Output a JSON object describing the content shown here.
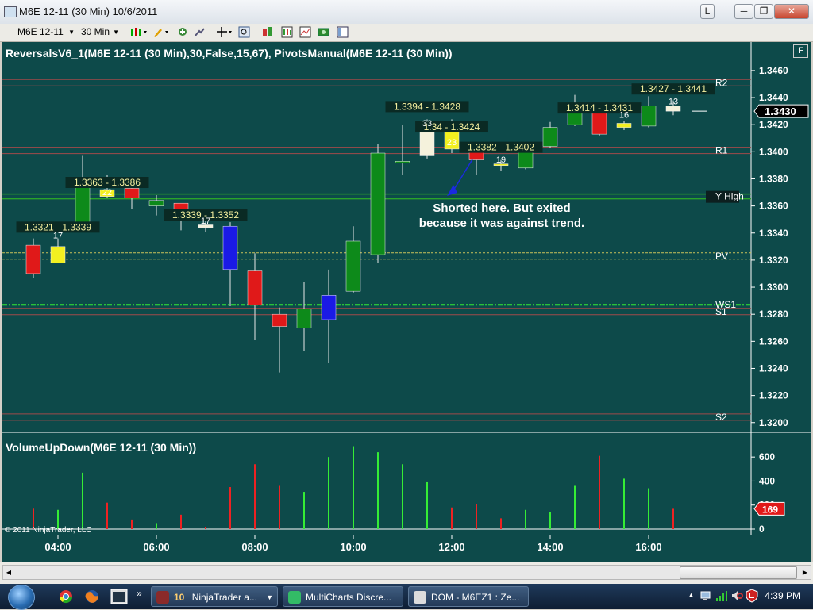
{
  "window": {
    "title": "M6E 12-11 (30 Min)  10/6/2011",
    "button_l": "L",
    "minimize": "─",
    "restore": "❐",
    "close": "✕"
  },
  "toolbar": {
    "instrument": "M6E 12-11",
    "period": "30 Min"
  },
  "price_panel": {
    "title": "ReversalsV6_1(M6E 12-11 (30 Min),30,False,15,67),  PivotsManual(M6E 12-11 (30 Min))",
    "f_button": "F",
    "price_ticks": [
      "1.3460",
      "1.3440",
      "1.3420",
      "1.3400",
      "1.3380",
      "1.3360",
      "1.3340",
      "1.3320",
      "1.3300",
      "1.3280",
      "1.3260",
      "1.3240",
      "1.3220",
      "1.3200"
    ],
    "last_price": "1.3430",
    "pivot_labels": {
      "r2": "R2",
      "r1": "R1",
      "yhigh": "Y High",
      "pv": "PV",
      "ws1": "WS1",
      "s1": "S1",
      "s2": "S2"
    },
    "annotation_text": [
      "Shorted here. But exited",
      "because it was against trend."
    ],
    "range_labels": [
      "1.3321 - 1.3339",
      "1.3363 - 1.3386",
      "1.3339 - 1.3352",
      "1.3394 - 1.3428",
      "1.34 - 1.3424",
      "1.3382 - 1.3402",
      "1.3414 - 1.3431",
      "1.3427 - 1.3441"
    ],
    "count_labels": [
      "17",
      "22",
      "17",
      "33",
      "23",
      "19",
      "16",
      "13"
    ]
  },
  "volume_panel": {
    "title": "VolumeUpDown(M6E 12-11 (30 Min))",
    "ticks": [
      "600",
      "400",
      "200",
      "0"
    ],
    "last_volume": "169"
  },
  "time_axis": [
    "04:00",
    "06:00",
    "08:00",
    "10:00",
    "12:00",
    "14:00",
    "16:00"
  ],
  "copyright": "© 2011 NinjaTrader, LLC",
  "taskbar": {
    "items": [
      {
        "count": "10",
        "label": "NinjaTrader a..."
      },
      {
        "label": "MultiCharts Discre..."
      },
      {
        "label": "DOM - M6EZ1 : Ze..."
      }
    ],
    "clock": "4:39 PM"
  },
  "colors": {
    "chart_bg": "#0d4a4a",
    "up": "#0d8a1a",
    "down": "#e01919",
    "yellow": "#f2f020",
    "blue": "#1a1ae6",
    "cream": "#f5f2dc"
  },
  "chart_data": {
    "type": "candlestick",
    "instrument": "M6E 12-11 (30 Min)",
    "y_range": [
      1.3194,
      1.3474
    ],
    "x_ticks": [
      "04:00",
      "06:00",
      "08:00",
      "10:00",
      "12:00",
      "14:00",
      "16:00"
    ],
    "candles": [
      {
        "time": "03:30",
        "open": 1.3331,
        "high": 1.3336,
        "low": 1.3307,
        "close": 1.331,
        "color": "red"
      },
      {
        "time": "04:00",
        "open": 1.333,
        "high": 1.3336,
        "low": 1.3318,
        "close": 1.3318,
        "color": "yellow"
      },
      {
        "time": "04:30",
        "open": 1.3346,
        "high": 1.3397,
        "low": 1.3344,
        "close": 1.3375,
        "color": "green"
      },
      {
        "time": "05:00",
        "open": 1.3372,
        "high": 1.3383,
        "low": 1.3366,
        "close": 1.3367,
        "color": "yellow"
      },
      {
        "time": "05:30",
        "open": 1.3373,
        "high": 1.3376,
        "low": 1.3358,
        "close": 1.3366,
        "color": "red"
      },
      {
        "time": "06:00",
        "open": 1.336,
        "high": 1.3368,
        "low": 1.3353,
        "close": 1.3364,
        "color": "green"
      },
      {
        "time": "06:30",
        "open": 1.3362,
        "high": 1.3359,
        "low": 1.3342,
        "close": 1.3355,
        "color": "red"
      },
      {
        "time": "07:00",
        "open": 1.3346,
        "high": 1.3349,
        "low": 1.3341,
        "close": 1.3344,
        "color": "cream"
      },
      {
        "time": "07:30",
        "open": 1.3345,
        "high": 1.3348,
        "low": 1.3286,
        "close": 1.3313,
        "color": "blue"
      },
      {
        "time": "08:00",
        "open": 1.3312,
        "high": 1.3325,
        "low": 1.3261,
        "close": 1.3287,
        "color": "red"
      },
      {
        "time": "08:30",
        "open": 1.328,
        "high": 1.3285,
        "low": 1.3237,
        "close": 1.3271,
        "color": "red"
      },
      {
        "time": "09:00",
        "open": 1.327,
        "high": 1.3304,
        "low": 1.3253,
        "close": 1.3284,
        "color": "green"
      },
      {
        "time": "09:30",
        "open": 1.3276,
        "high": 1.3313,
        "low": 1.3244,
        "close": 1.3294,
        "color": "blue"
      },
      {
        "time": "10:00",
        "open": 1.3297,
        "high": 1.3345,
        "low": 1.3296,
        "close": 1.3334,
        "color": "green"
      },
      {
        "time": "10:30",
        "open": 1.3324,
        "high": 1.3406,
        "low": 1.3318,
        "close": 1.3399,
        "color": "green"
      },
      {
        "time": "11:00",
        "open": 1.3393,
        "high": 1.342,
        "low": 1.3383,
        "close": 1.3393,
        "color": "green"
      },
      {
        "time": "11:30",
        "open": 1.3397,
        "high": 1.3424,
        "low": 1.3395,
        "close": 1.3415,
        "color": "cream"
      },
      {
        "time": "12:00",
        "open": 1.342,
        "high": 1.3424,
        "low": 1.3399,
        "close": 1.3402,
        "color": "yellow"
      },
      {
        "time": "12:30",
        "open": 1.3404,
        "high": 1.3402,
        "low": 1.3383,
        "close": 1.3394,
        "color": "red"
      },
      {
        "time": "13:00",
        "open": 1.339,
        "high": 1.3394,
        "low": 1.3386,
        "close": 1.3391,
        "color": "yellow"
      },
      {
        "time": "13:30",
        "open": 1.3388,
        "high": 1.3404,
        "low": 1.3387,
        "close": 1.3403,
        "color": "green"
      },
      {
        "time": "14:00",
        "open": 1.3404,
        "high": 1.3422,
        "low": 1.3403,
        "close": 1.3418,
        "color": "green"
      },
      {
        "time": "14:30",
        "open": 1.342,
        "high": 1.3442,
        "low": 1.3419,
        "close": 1.3435,
        "color": "green"
      },
      {
        "time": "15:00",
        "open": 1.3435,
        "high": 1.3435,
        "low": 1.3412,
        "close": 1.3413,
        "color": "red"
      },
      {
        "time": "15:30",
        "open": 1.3418,
        "high": 1.3423,
        "low": 1.3416,
        "close": 1.3421,
        "color": "yellow"
      },
      {
        "time": "16:00",
        "open": 1.3419,
        "high": 1.3441,
        "low": 1.3418,
        "close": 1.3434,
        "color": "green"
      },
      {
        "time": "16:30",
        "open": 1.343,
        "high": 1.3438,
        "low": 1.3427,
        "close": 1.3434,
        "color": "cream"
      }
    ],
    "pivot_levels": [
      {
        "name": "R2",
        "price": 1.3451
      },
      {
        "name": "R1",
        "price": 1.3401
      },
      {
        "name": "Y High",
        "price": 1.3367
      },
      {
        "name": "PV",
        "price": 1.3323
      },
      {
        "name": "WS1",
        "price": 1.3287
      },
      {
        "name": "S1",
        "price": 1.3282
      },
      {
        "name": "S2",
        "price": 1.3204
      }
    ],
    "range_markers": [
      {
        "text": "1.3321 - 1.3339",
        "time": "04:00",
        "price": 1.3342
      },
      {
        "text": "1.3363 - 1.3386",
        "time": "05:00",
        "price": 1.3375
      },
      {
        "text": "1.3339 - 1.3352",
        "time": "07:00",
        "price": 1.3351
      },
      {
        "text": "1.3394 - 1.3428",
        "time": "11:30",
        "price": 1.3431
      },
      {
        "text": "1.34 - 1.3424",
        "time": "12:00",
        "price": 1.3416
      },
      {
        "text": "1.3382 - 1.3402",
        "time": "13:00",
        "price": 1.3401
      },
      {
        "text": "1.3414 - 1.3431",
        "time": "15:00",
        "price": 1.343
      },
      {
        "text": "1.3427 - 1.3441",
        "time": "16:30",
        "price": 1.3444
      }
    ],
    "count_markers": [
      {
        "text": "17",
        "time": "04:00",
        "price": 1.3336
      },
      {
        "text": "22",
        "time": "05:00",
        "price": 1.3368
      },
      {
        "text": "17",
        "time": "07:00",
        "price": 1.3347
      },
      {
        "text": "33",
        "time": "11:30",
        "price": 1.3419
      },
      {
        "text": "23",
        "time": "12:00",
        "price": 1.3405
      },
      {
        "text": "19",
        "time": "13:00",
        "price": 1.3392
      },
      {
        "text": "16",
        "time": "15:30",
        "price": 1.3425
      },
      {
        "text": "13",
        "time": "16:30",
        "price": 1.3435
      }
    ],
    "volume": {
      "y_range": [
        0,
        720
      ],
      "bars": [
        {
          "time": "03:30",
          "value": 170,
          "dir": "down"
        },
        {
          "time": "04:00",
          "value": 160,
          "dir": "up"
        },
        {
          "time": "04:30",
          "value": 470,
          "dir": "up"
        },
        {
          "time": "05:00",
          "value": 220,
          "dir": "down"
        },
        {
          "time": "05:30",
          "value": 80,
          "dir": "down"
        },
        {
          "time": "06:00",
          "value": 50,
          "dir": "up"
        },
        {
          "time": "06:30",
          "value": 120,
          "dir": "down"
        },
        {
          "time": "07:00",
          "value": 20,
          "dir": "down"
        },
        {
          "time": "07:30",
          "value": 350,
          "dir": "down"
        },
        {
          "time": "08:00",
          "value": 540,
          "dir": "down"
        },
        {
          "time": "08:30",
          "value": 360,
          "dir": "down"
        },
        {
          "time": "09:00",
          "value": 310,
          "dir": "up"
        },
        {
          "time": "09:30",
          "value": 600,
          "dir": "up"
        },
        {
          "time": "10:00",
          "value": 690,
          "dir": "up"
        },
        {
          "time": "10:30",
          "value": 640,
          "dir": "up"
        },
        {
          "time": "11:00",
          "value": 540,
          "dir": "up"
        },
        {
          "time": "11:30",
          "value": 390,
          "dir": "up"
        },
        {
          "time": "12:00",
          "value": 180,
          "dir": "down"
        },
        {
          "time": "12:30",
          "value": 210,
          "dir": "down"
        },
        {
          "time": "13:00",
          "value": 90,
          "dir": "down"
        },
        {
          "time": "13:30",
          "value": 160,
          "dir": "up"
        },
        {
          "time": "14:00",
          "value": 140,
          "dir": "up"
        },
        {
          "time": "14:30",
          "value": 360,
          "dir": "up"
        },
        {
          "time": "15:00",
          "value": 610,
          "dir": "down"
        },
        {
          "time": "15:30",
          "value": 420,
          "dir": "up"
        },
        {
          "time": "16:00",
          "value": 340,
          "dir": "up"
        },
        {
          "time": "16:30",
          "value": 169,
          "dir": "down"
        }
      ]
    }
  }
}
